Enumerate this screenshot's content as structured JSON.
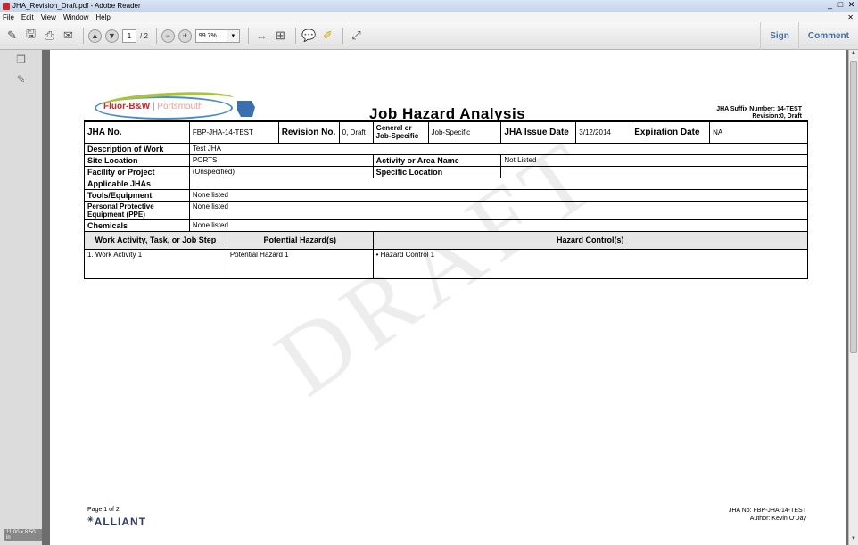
{
  "window": {
    "title": "JHA_Revision_Draft.pdf - Adobe Reader",
    "controls": [
      "_",
      "□",
      "✕"
    ]
  },
  "menu": {
    "items": [
      "File",
      "Edit",
      "View",
      "Window",
      "Help"
    ],
    "close": "✕"
  },
  "toolbar": {
    "page_current": "1",
    "page_total": "/ 2",
    "zoom": "99.7%",
    "sign_label": "Sign",
    "comment_label": "Comment"
  },
  "leftpane": {
    "page_size": "11.00 x 8.50 in"
  },
  "document": {
    "logo": {
      "fluor": "Fluor-B&W",
      "sep": "|",
      "portsmouth": "Portsmouth"
    },
    "title": "Job Hazard Analysis",
    "suffix_line1": "JHA Suffix Number: 14-TEST",
    "suffix_line2": "Revision:0, Draft",
    "watermark": "DRAFT",
    "header_row": {
      "jha_no_label": "JHA No.",
      "jha_no_value": "FBP-JHA-14-TEST",
      "revision_label": "Revision No.",
      "revision_value": "0, Draft",
      "general_label": "General or Job-Specific",
      "general_value": "Job-Specific",
      "issue_date_label": "JHA Issue Date",
      "issue_date_value": "3/12/2014",
      "expiration_label": "Expiration Date",
      "expiration_value": "NA"
    },
    "rows": {
      "description_label": "Description of Work",
      "description_value": "Test JHA",
      "site_label": "Site Location",
      "site_value": "PORTS",
      "activity_area_label": "Activity or Area Name",
      "activity_area_value": "Not Listed",
      "facility_label": "Facility or Project",
      "facility_value": "(Unspecified)",
      "specific_location_label": "Specific Location",
      "specific_location_value": "",
      "applicable_label": "Applicable JHAs",
      "applicable_value": "",
      "tools_label": "Tools/Equipment",
      "tools_value": "None listed",
      "ppe_label": "Personal Protective Equipment (PPE)",
      "ppe_value": "None listed",
      "chemicals_label": "Chemicals",
      "chemicals_value": "None listed"
    },
    "columns": {
      "activity": "Work Activity, Task, or Job Step",
      "hazards": "Potential Hazard(s)",
      "controls": "Hazard Control(s)"
    },
    "activity_row": {
      "activity": "1. Work Activity 1",
      "hazard": "Potential Hazard 1",
      "control": "Hazard Control 1"
    },
    "footer": {
      "page": "Page 1 of 2",
      "alliant": "ALLIANT",
      "jha_no": "JHA No: FBP-JHA-14-TEST",
      "author": "Author: Kevin O'Day"
    }
  }
}
